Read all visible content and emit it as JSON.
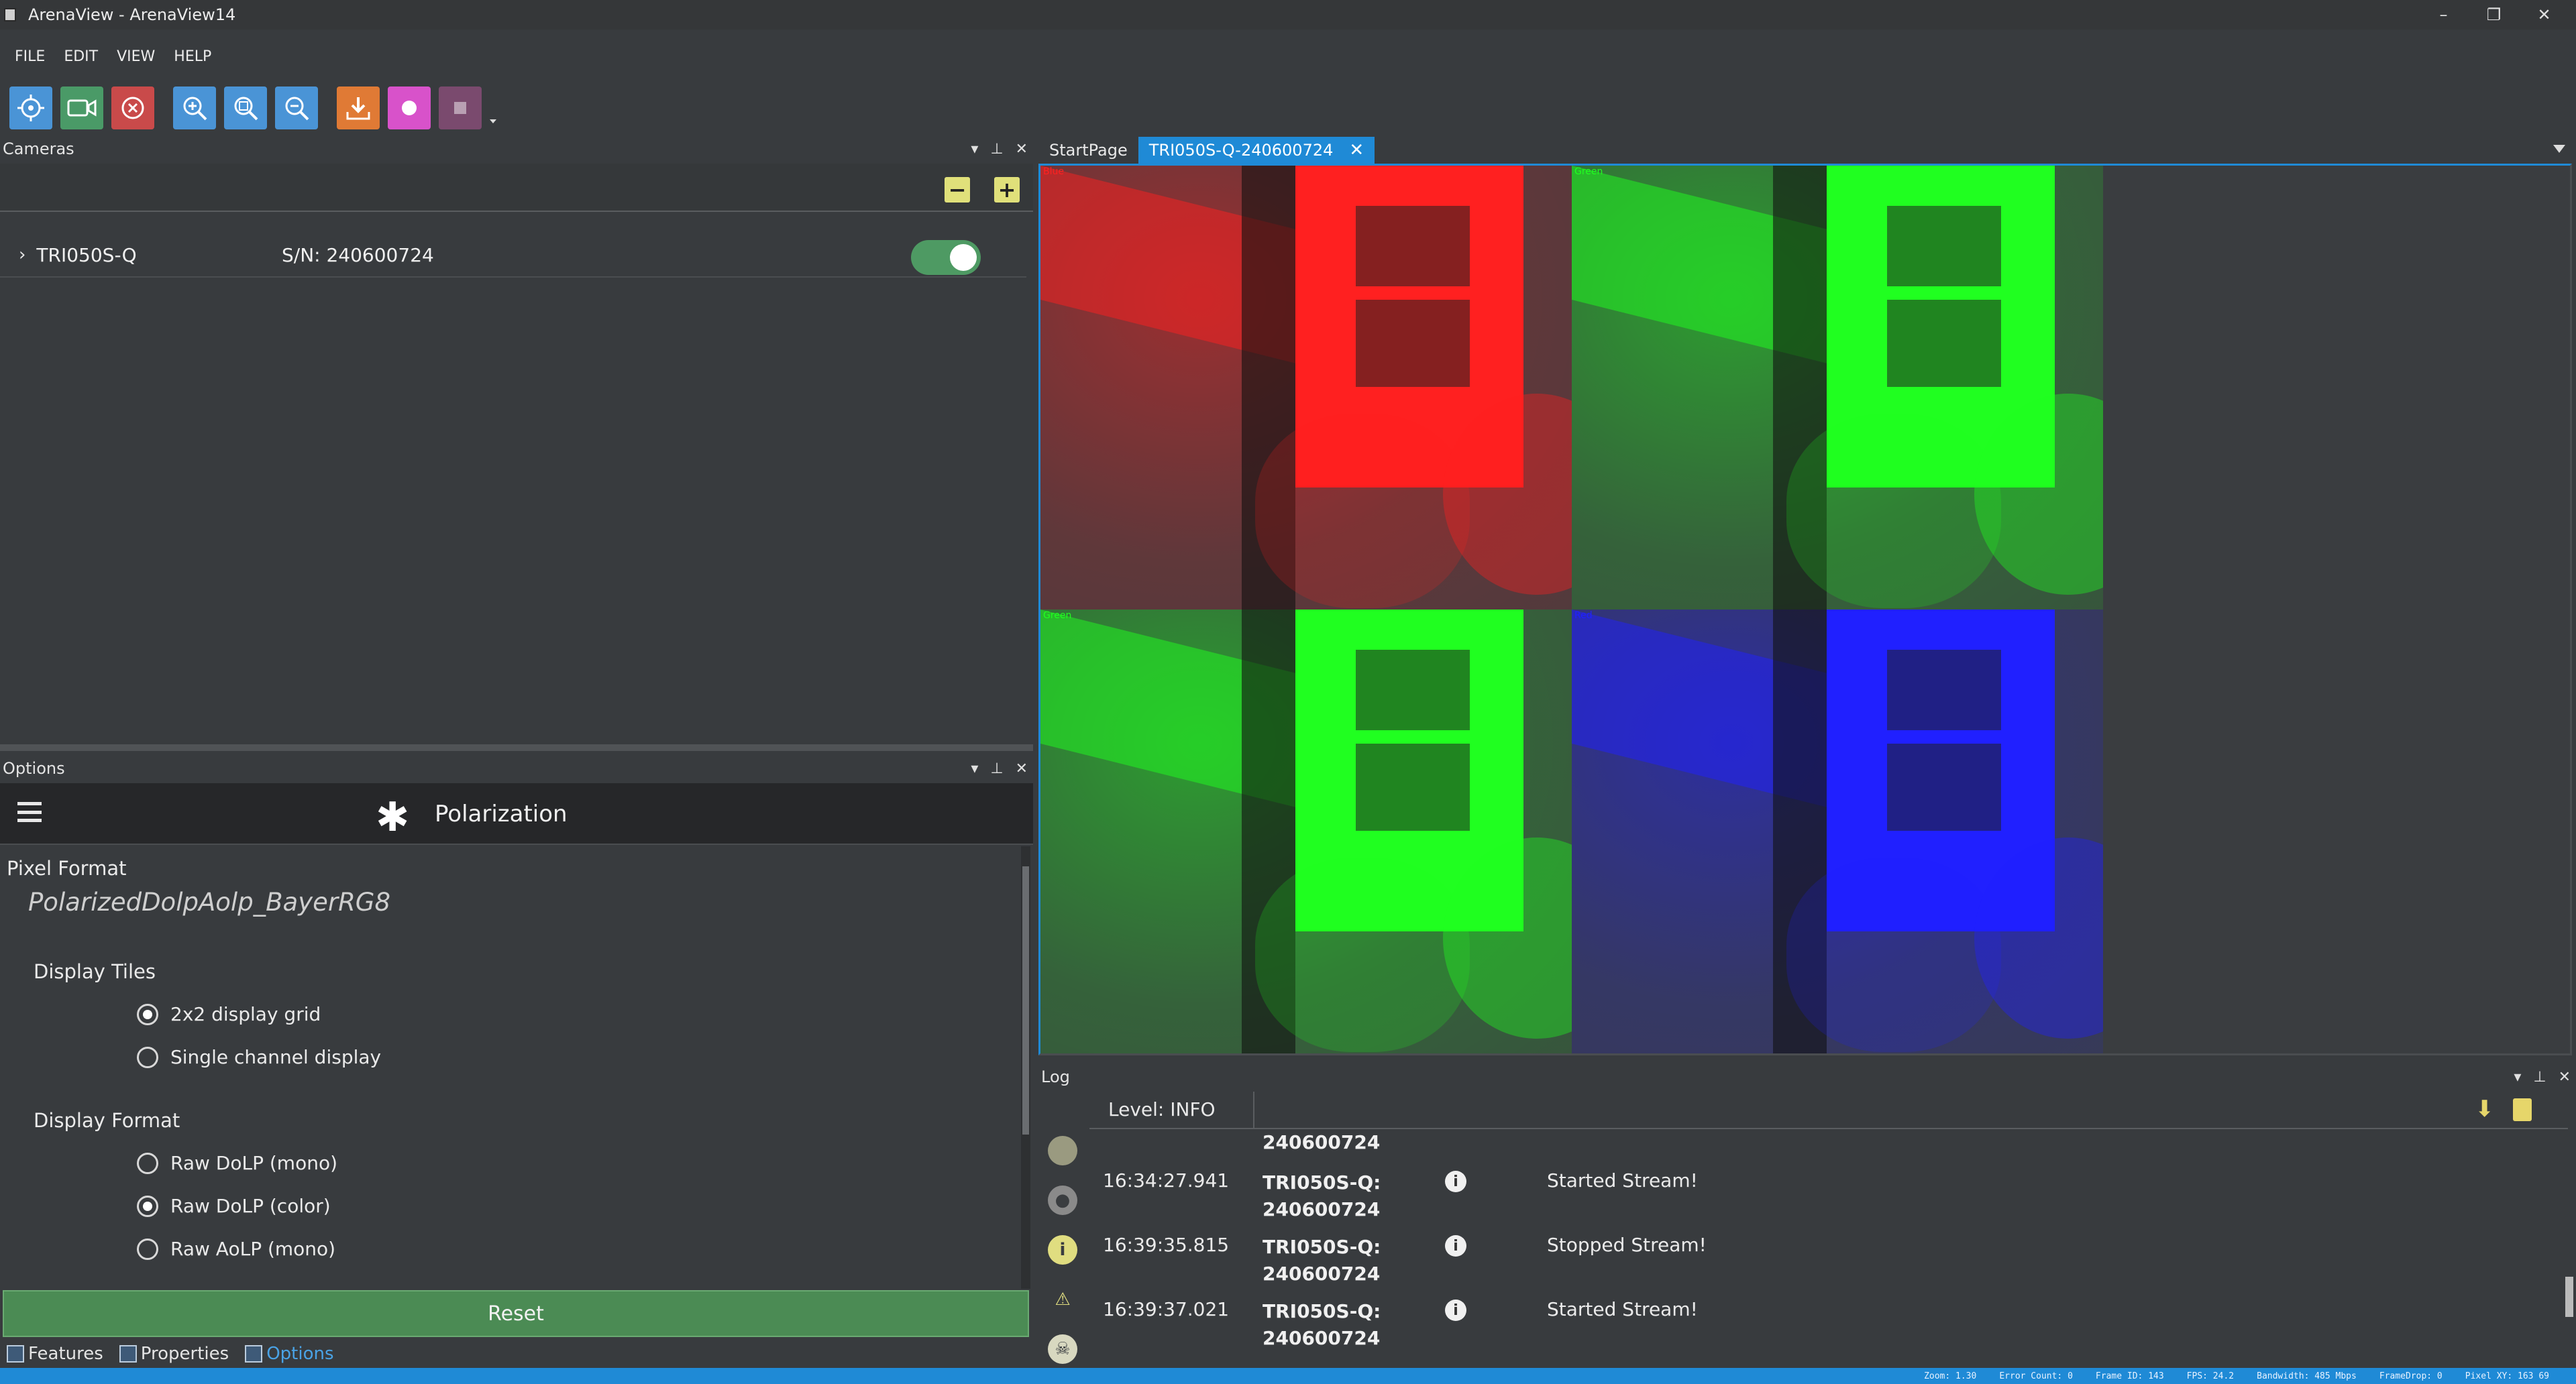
{
  "window": {
    "title": "ArenaView - ArenaView14",
    "buttons": [
      "–",
      "❐",
      "✕"
    ]
  },
  "menu": [
    "FILE",
    "EDIT",
    "VIEW",
    "HELP"
  ],
  "toolbar": {
    "buttons": [
      {
        "icon": "crosshair-icon",
        "color": "#4a94d6"
      },
      {
        "icon": "video-camera-icon",
        "color": "#4a9a67"
      },
      {
        "icon": "stop-circle-icon",
        "color": "#c94a4a"
      },
      {
        "icon": "zoom-in-icon",
        "color": "#4a94d6"
      },
      {
        "icon": "zoom-fit-icon",
        "color": "#4a94d6"
      },
      {
        "icon": "zoom-out-icon",
        "color": "#4a94d6"
      },
      {
        "icon": "download-icon",
        "color": "#e07a35"
      },
      {
        "icon": "record-icon",
        "color": "#d852ca"
      },
      {
        "icon": "stop-square-icon",
        "color": "#7a4a6e"
      }
    ]
  },
  "cameras_panel": {
    "title": "Cameras",
    "camera": {
      "name": "TRI050S-Q",
      "serial": "S/N: 240600724",
      "enabled": true
    }
  },
  "options_panel": {
    "title": "Options",
    "hero_title": "Polarization",
    "pixel_format_label": "Pixel Format",
    "pixel_format_value": "PolarizedDolpAolp_BayerRG8",
    "display_tiles_label": "Display Tiles",
    "display_tiles": [
      {
        "label": "2x2 display grid",
        "checked": true
      },
      {
        "label": "Single channel display",
        "checked": false
      }
    ],
    "display_format_label": "Display Format",
    "display_format": [
      {
        "label": "Raw DoLP (mono)",
        "checked": false
      },
      {
        "label": "Raw DoLP (color)",
        "checked": true
      },
      {
        "label": "Raw AoLP (mono)",
        "checked": false
      }
    ],
    "reset_label": "Reset"
  },
  "bottom_tabs": [
    "Features",
    "Properties",
    "Options"
  ],
  "doc_tabs": [
    {
      "label": "StartPage",
      "active": false
    },
    {
      "label": "TRI050S-Q-240600724",
      "active": true
    }
  ],
  "tiles": [
    {
      "label": "Blue",
      "color": "#ff2020"
    },
    {
      "label": "Green",
      "color": "#20ff20"
    },
    {
      "label": "Green",
      "color": "#20ff20"
    },
    {
      "label": "Red",
      "color": "#2020ff"
    }
  ],
  "log_panel": {
    "title": "Log",
    "level": "Level: INFO",
    "partial_source": "240600724",
    "entries": [
      {
        "time": "16:34:27.941",
        "source": "TRI050S-Q:",
        "source2": "240600724",
        "message": "Started Stream!"
      },
      {
        "time": "16:39:35.815",
        "source": "TRI050S-Q:",
        "source2": "240600724",
        "message": "Stopped Stream!"
      },
      {
        "time": "16:39:37.021",
        "source": "TRI050S-Q:",
        "source2": "240600724",
        "message": "Started Stream!"
      }
    ]
  },
  "statusbar": [
    "Zoom: 1.30",
    "Error Count: 0",
    "Frame ID: 143",
    "FPS: 24.2",
    "Bandwidth: 485 Mbps",
    "FrameDrop: 0",
    "Pixel XY: 163 69"
  ]
}
